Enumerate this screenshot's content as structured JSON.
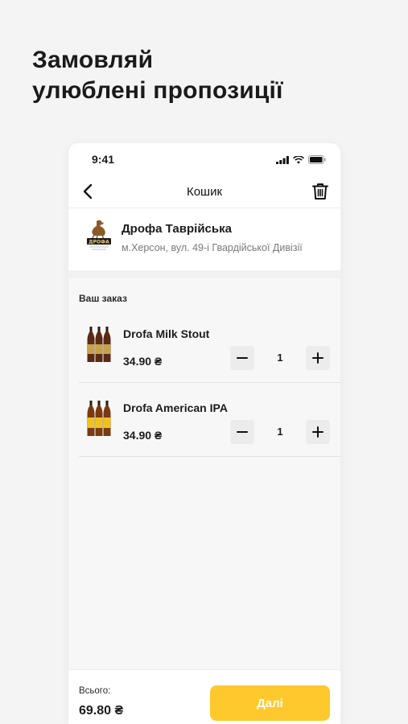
{
  "headline": {
    "line1": "Замовляй",
    "line2": "улюблені пропозиції"
  },
  "status_bar": {
    "time": "9:41",
    "icons": [
      "signal-icon",
      "wifi-icon",
      "battery-icon"
    ]
  },
  "nav": {
    "title": "Кошик",
    "back_icon": "chevron-left-icon",
    "action_icon": "trash-icon"
  },
  "store": {
    "name": "Дрофа Таврійська",
    "address": "м.Херсон, вул. 49-і Гвардійської Дивізії",
    "logo_text": "ДРОФА"
  },
  "order": {
    "section_label": "Ваш заказ",
    "items": [
      {
        "name": "Drofa Milk Stout",
        "price": "34.90 ₴",
        "quantity": "1",
        "label_color": "#c8a24a",
        "bottle_color": "#5a2a14"
      },
      {
        "name": "Drofa American IPA",
        "price": "34.90 ₴",
        "quantity": "1",
        "label_color": "#f0c21c",
        "bottle_color": "#7a3b10"
      }
    ]
  },
  "footer": {
    "total_label": "Всього:",
    "total_value": "69.80 ₴",
    "next_label": "Далі"
  },
  "colors": {
    "accent": "#ffc82c",
    "background": "#f4f4f4",
    "muted_text": "#7a7a7a"
  }
}
